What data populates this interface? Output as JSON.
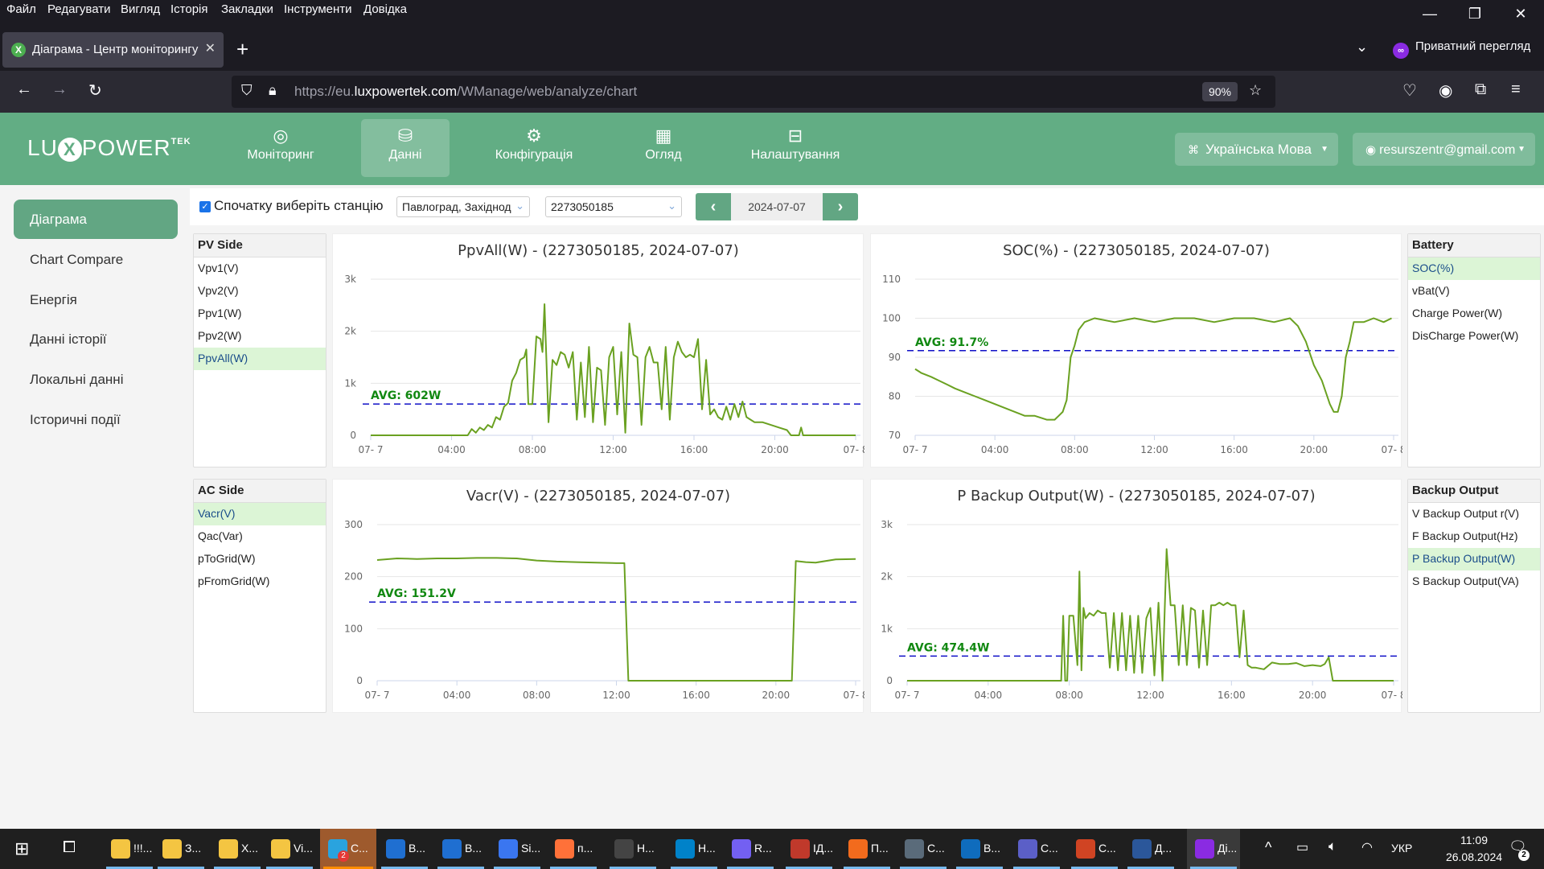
{
  "browser": {
    "menu": [
      "Файл",
      "Редагувати",
      "Вигляд",
      "Історія",
      "Закладки",
      "Інструменти",
      "Довідка"
    ],
    "tab_title": "Діаграма - Центр моніторингу",
    "private_label": "Приватний перегляд",
    "url_prefix": "https://eu.",
    "url_domain": "luxpowertek.com",
    "url_path": "/WManage/web/analyze/chart",
    "zoom": "90%"
  },
  "app": {
    "logo": "LU",
    "logo_x": "X",
    "logo_rest": "POWER",
    "logo_sup": "TEK",
    "nav": [
      {
        "label": "Моніторинг",
        "icon": "compass-icon",
        "glyph": "◎"
      },
      {
        "label": "Данні",
        "icon": "database-icon",
        "glyph": "⛁"
      },
      {
        "label": "Конфігурація",
        "icon": "gear-icon",
        "glyph": "⚙"
      },
      {
        "label": "Огляд",
        "icon": "grid-icon",
        "glyph": "▦"
      },
      {
        "label": "Налаштування",
        "icon": "briefcase-icon",
        "glyph": "⊟"
      }
    ],
    "language": "Українська Мова",
    "user": "resurszentr@gmail.com"
  },
  "sidebar": {
    "items": [
      "Діаграма",
      "Chart Compare",
      "Енергія",
      "Данні історії",
      "Локальні данні",
      "Історичні події"
    ]
  },
  "controls": {
    "checkbox_label": "Спочатку виберіть станцію",
    "checked": true,
    "station": "Павлоград, Західнод",
    "serial": "2273050185",
    "date": "2024-07-07"
  },
  "panels": {
    "pv": {
      "title": "PV Side",
      "items": [
        "Vpv1(V)",
        "Vpv2(V)",
        "Ppv1(W)",
        "Ppv2(W)",
        "PpvAll(W)"
      ],
      "selected": 4
    },
    "battery": {
      "title": "Battery",
      "items": [
        "SOC(%)",
        "vBat(V)",
        "Charge Power(W)",
        "DisCharge Power(W)"
      ],
      "selected": 0
    },
    "ac": {
      "title": "AC Side",
      "items": [
        "Vacr(V)",
        "Qac(Var)",
        "pToGrid(W)",
        "pFromGrid(W)"
      ],
      "selected": 0
    },
    "backup": {
      "title": "Backup Output",
      "items": [
        "V Backup Output r(V)",
        "F Backup Output(Hz)",
        "P Backup Output(W)",
        "S Backup Output(VA)"
      ],
      "selected": 2
    }
  },
  "chart_data": [
    {
      "type": "line",
      "title": "PpvAll(W) - (2273050185, 2024-07-07)",
      "xlabel": "",
      "ylabel": "",
      "x_ticks": [
        "07- 7",
        "04:00",
        "08:00",
        "12:00",
        "16:00",
        "20:00",
        "07- 8"
      ],
      "y_ticks": [
        "0",
        "1k",
        "2k",
        "3k"
      ],
      "ylim": [
        0,
        3000
      ],
      "avg": 602,
      "avg_label": "AVG: 602W",
      "series": [
        {
          "name": "PpvAll(W)",
          "x_hours": [
            0,
            4.8,
            5.0,
            5.2,
            5.4,
            5.6,
            5.8,
            6.0,
            6.2,
            6.4,
            6.6,
            6.8,
            7.0,
            7.2,
            7.4,
            7.6,
            7.7,
            7.8,
            8.0,
            8.2,
            8.4,
            8.5,
            8.6,
            8.8,
            9.0,
            9.2,
            9.4,
            9.6,
            9.8,
            10.0,
            10.2,
            10.4,
            10.6,
            10.8,
            11.0,
            11.2,
            11.4,
            11.6,
            11.8,
            12.0,
            12.2,
            12.4,
            12.6,
            12.8,
            13.0,
            13.2,
            13.4,
            13.6,
            13.8,
            14.0,
            14.2,
            14.4,
            14.6,
            14.8,
            15.0,
            15.2,
            15.4,
            15.6,
            15.8,
            16.0,
            16.2,
            16.4,
            16.6,
            16.8,
            17.0,
            17.2,
            17.4,
            17.6,
            17.8,
            18.0,
            18.2,
            18.4,
            18.6,
            18.8,
            19.0,
            19.4,
            19.8,
            20.2,
            20.6,
            20.8,
            21.2,
            21.3,
            21.4,
            24
          ],
          "values": [
            0,
            0,
            120,
            50,
            150,
            100,
            200,
            150,
            350,
            300,
            550,
            620,
            1050,
            1200,
            1450,
            1500,
            1650,
            600,
            600,
            1900,
            1850,
            1600,
            2520,
            250,
            1450,
            1350,
            1600,
            1550,
            1300,
            1600,
            300,
            1400,
            350,
            1700,
            250,
            1300,
            1250,
            200,
            1500,
            1700,
            400,
            1600,
            50,
            2150,
            1550,
            1500,
            200,
            1500,
            1700,
            1400,
            1400,
            500,
            1700,
            300,
            1500,
            1800,
            1600,
            1500,
            1550,
            1500,
            1850,
            500,
            1450,
            400,
            500,
            350,
            300,
            550,
            300,
            600,
            350,
            650,
            350,
            300,
            250,
            250,
            200,
            150,
            100,
            0,
            0,
            150,
            0,
            0
          ]
        }
      ]
    },
    {
      "type": "line",
      "title": "SOC(%) - (2273050185, 2024-07-07)",
      "xlabel": "",
      "ylabel": "",
      "x_ticks": [
        "07- 7",
        "04:00",
        "08:00",
        "12:00",
        "16:00",
        "20:00",
        "07- 8"
      ],
      "y_ticks": [
        "70",
        "80",
        "90",
        "100",
        "110"
      ],
      "ylim": [
        70,
        110
      ],
      "avg": 91.7,
      "avg_label": "AVG: 91.7%",
      "series": [
        {
          "name": "SOC(%)",
          "x_hours": [
            0,
            0.3,
            0.8,
            1.2,
            1.6,
            2.0,
            2.5,
            3.0,
            3.5,
            4.0,
            4.5,
            5.0,
            5.5,
            6.0,
            6.6,
            7.0,
            7.2,
            7.4,
            7.6,
            7.8,
            8.0,
            8.2,
            8.5,
            9.0,
            10.0,
            11.0,
            12.0,
            13.0,
            14.0,
            15.0,
            16.0,
            17.0,
            18.0,
            18.8,
            19.2,
            19.6,
            20.0,
            20.4,
            20.8,
            21.0,
            21.2,
            21.4,
            21.6,
            21.8,
            22.0,
            22.5,
            23.0,
            23.5,
            23.9
          ],
          "values": [
            87,
            86,
            85,
            84,
            83,
            82,
            81,
            80,
            79,
            78,
            77,
            76,
            75,
            75,
            74,
            74,
            75,
            76,
            79,
            90,
            93,
            97,
            99,
            100,
            99,
            100,
            99,
            100,
            100,
            99,
            100,
            100,
            99,
            100,
            98,
            94,
            88,
            84,
            78,
            76,
            76,
            80,
            90,
            94,
            99,
            99,
            100,
            99,
            100
          ]
        }
      ]
    },
    {
      "type": "line",
      "title": "Vacr(V) - (2273050185, 2024-07-07)",
      "xlabel": "",
      "ylabel": "",
      "x_ticks": [
        "07- 7",
        "04:00",
        "08:00",
        "12:00",
        "16:00",
        "20:00",
        "07- 8"
      ],
      "y_ticks": [
        "0",
        "100",
        "200",
        "300"
      ],
      "ylim": [
        0,
        300
      ],
      "avg": 151.2,
      "avg_label": "AVG: 151.2V",
      "series": [
        {
          "name": "Vacr(V)",
          "x_hours": [
            0,
            1,
            2,
            3,
            4,
            5,
            6,
            7,
            8,
            9,
            10,
            11,
            12,
            12.4,
            12.6,
            20.8,
            21.0,
            21.5,
            22,
            23,
            24
          ],
          "values": [
            232,
            235,
            234,
            235,
            235,
            236,
            236,
            235,
            231,
            229,
            228,
            227,
            226,
            226,
            0,
            0,
            230,
            228,
            227,
            233,
            234
          ]
        }
      ]
    },
    {
      "type": "line",
      "title": "P Backup Output(W) - (2273050185, 2024-07-07)",
      "xlabel": "",
      "ylabel": "",
      "x_ticks": [
        "07- 7",
        "04:00",
        "08:00",
        "12:00",
        "16:00",
        "20:00",
        "07- 8"
      ],
      "y_ticks": [
        "0",
        "1k",
        "2k",
        "3k"
      ],
      "ylim": [
        0,
        3000
      ],
      "avg": 474.4,
      "avg_label": "AVG: 474.4W",
      "series": [
        {
          "name": "P Backup Output(W)",
          "x_hours": [
            0,
            7.6,
            7.7,
            7.8,
            7.9,
            8.0,
            8.2,
            8.4,
            8.5,
            8.6,
            8.7,
            8.8,
            9.0,
            9.2,
            9.4,
            9.6,
            9.8,
            10.0,
            10.2,
            10.4,
            10.6,
            10.8,
            11.0,
            11.2,
            11.4,
            11.6,
            11.8,
            12.0,
            12.2,
            12.4,
            12.6,
            12.8,
            13.0,
            13.2,
            13.4,
            13.6,
            13.8,
            14.0,
            14.2,
            14.4,
            14.6,
            14.8,
            15.0,
            15.2,
            15.4,
            15.6,
            15.8,
            16.0,
            16.2,
            16.4,
            16.6,
            16.8,
            17.0,
            17.2,
            17.6,
            18.0,
            18.4,
            18.8,
            19.2,
            19.6,
            20.0,
            20.4,
            20.6,
            20.8,
            21.0,
            24
          ],
          "values": [
            0,
            0,
            1250,
            0,
            0,
            1250,
            1250,
            300,
            2100,
            200,
            1400,
            1200,
            1300,
            1250,
            1350,
            1300,
            1300,
            250,
            1300,
            200,
            1300,
            200,
            1250,
            150,
            1250,
            150,
            1200,
            1400,
            100,
            1500,
            0,
            2530,
            1450,
            1450,
            300,
            1450,
            300,
            1400,
            1350,
            250,
            1350,
            300,
            1450,
            1450,
            1500,
            1450,
            1500,
            1450,
            1450,
            450,
            1350,
            300,
            250,
            250,
            220,
            350,
            320,
            320,
            340,
            280,
            300,
            280,
            320,
            450,
            0,
            0
          ]
        }
      ]
    }
  ],
  "taskbar": {
    "items": [
      {
        "label": "!!!...",
        "icon": "folder-icon",
        "color": "#f4c542"
      },
      {
        "label": "З...",
        "icon": "downloads-folder-icon",
        "color": "#f4c542"
      },
      {
        "label": "Х...",
        "icon": "folder-icon",
        "color": "#f4c542"
      },
      {
        "label": "Vi...",
        "icon": "folder-icon",
        "color": "#f4c542"
      },
      {
        "label": "С...",
        "icon": "telegram-icon",
        "color": "#2aa3de",
        "badge": "2"
      },
      {
        "label": "В...",
        "icon": "thunderbird-icon",
        "color": "#1f6fd1"
      },
      {
        "label": "В...",
        "icon": "thunderbird-icon",
        "color": "#1f6fd1"
      },
      {
        "label": "Si...",
        "icon": "signal-icon",
        "color": "#3a76f0"
      },
      {
        "label": "п...",
        "icon": "firefox-icon",
        "color": "#ff7139"
      },
      {
        "label": "Н...",
        "icon": "settings-icon",
        "color": "#444444"
      },
      {
        "label": "Н...",
        "icon": "nextcloud-icon",
        "color": "#0082c9"
      },
      {
        "label": "R...",
        "icon": "viber-icon",
        "color": "#7360f2"
      },
      {
        "label": "ІД...",
        "icon": "pdf-app-icon",
        "color": "#c0392b"
      },
      {
        "label": "П...",
        "icon": "reader-icon",
        "color": "#f26b1d"
      },
      {
        "label": "С...",
        "icon": "calculator-icon",
        "color": "#5a6b7a"
      },
      {
        "label": "В...",
        "icon": "outlook-icon",
        "color": "#0f6cbd"
      },
      {
        "label": "С...",
        "icon": "teams-icon",
        "color": "#5b5fc7"
      },
      {
        "label": "С...",
        "icon": "powerpoint-icon",
        "color": "#d04423"
      },
      {
        "label": "Д...",
        "icon": "word-icon",
        "color": "#2b579a"
      },
      {
        "label": "Ді...",
        "icon": "firefox-private-icon",
        "color": "#8a2be2"
      }
    ],
    "lang": "УКР",
    "time": "11:09",
    "date": "26.08.2024",
    "notifications": "2"
  }
}
